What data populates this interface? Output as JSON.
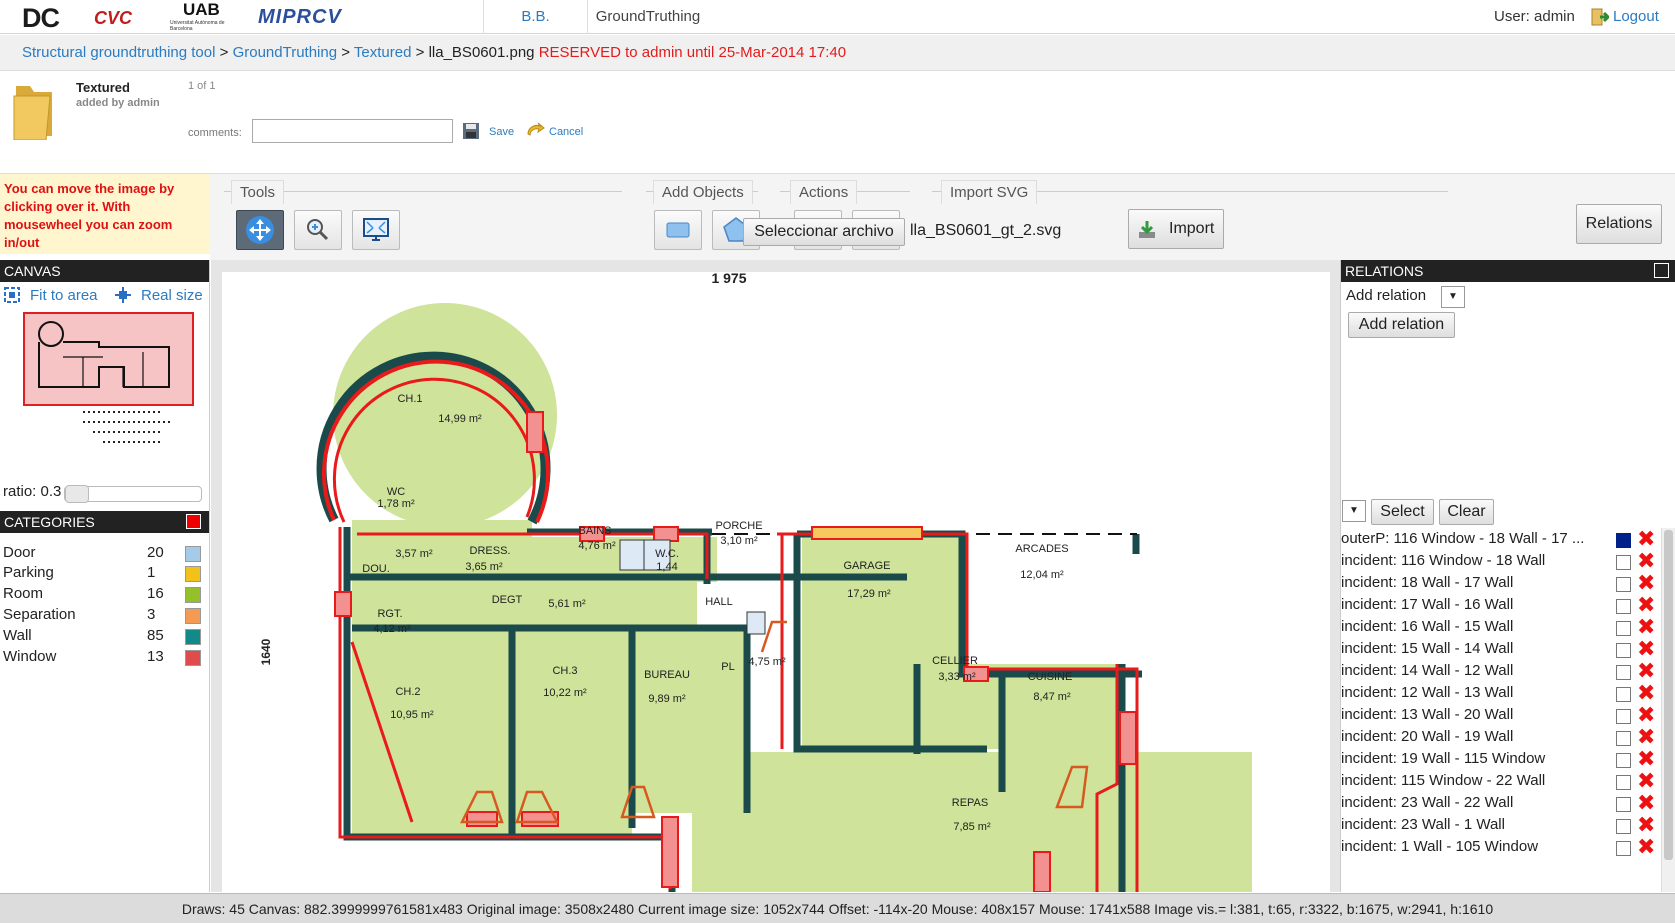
{
  "header": {
    "logos": [
      "DC",
      "CVC",
      "UAB",
      "MIPRCV"
    ],
    "uab_sub": "Universitat Autònoma de Barcelona",
    "tabs": [
      "B.B.",
      "GroundTruthing"
    ],
    "user_label": "User: admin",
    "logout_label": "Logout"
  },
  "breadcrumb": {
    "items": [
      "Structural groundtruthing tool",
      "GroundTruthing",
      "Textured"
    ],
    "separator": ">",
    "filename": "lla_BS0601.png",
    "reserved": "RESERVED to admin until 25-Mar-2014 17:40"
  },
  "doc": {
    "title": "Textured",
    "added_by": "added by admin",
    "pager": "1 of 1",
    "comments_label": "comments:",
    "comments_value": "",
    "save_label": "Save",
    "cancel_label": "Cancel"
  },
  "hint": "You can move the image by clicking over it. With mousewheel you can zoom in/out",
  "toolbar": {
    "tools_label": "Tools",
    "add_objects_label": "Add Objects",
    "actions_label": "Actions",
    "import_svg_label": "Import SVG",
    "file_button_label": "Seleccionar archivo",
    "file_name": "lla_BS0601_gt_2.svg",
    "import_label": "Import",
    "relations_label": "Relations"
  },
  "canvas": {
    "header": "CANVAS",
    "fit_label": "Fit to area",
    "real_label": "Real size",
    "ratio_label": "ratio: 0.3",
    "ratio_value": 0.3
  },
  "plan": {
    "top_dimension": "1 975",
    "side_dimension": "1640",
    "rooms": [
      {
        "name": "CH.1",
        "area": "14,99 m²"
      },
      {
        "name": "WC",
        "area": "1,78 m²"
      },
      {
        "name": "DOU.",
        "area": "3,57 m²"
      },
      {
        "name": "DRESS.",
        "area": "3,65 m²"
      },
      {
        "name": "BAINS",
        "area": "4,76 m²"
      },
      {
        "name": "W.C.",
        "area": "1,44"
      },
      {
        "name": "PORCHE",
        "area": "3,10 m²"
      },
      {
        "name": "GARAGE",
        "area": "17,29 m²"
      },
      {
        "name": "ARCADES",
        "area": "12,04 m²"
      },
      {
        "name": "RGT.",
        "area": "4,12 m²"
      },
      {
        "name": "DEGT",
        "area": "5,61 m²"
      },
      {
        "name": "HALL",
        "area": "4,75 m²"
      },
      {
        "name": "PL",
        "area": ""
      },
      {
        "name": "CELLIER",
        "area": "3,33 m²"
      },
      {
        "name": "CUISINE",
        "area": "8,47 m²"
      },
      {
        "name": "CH.2",
        "area": "10,95 m²"
      },
      {
        "name": "CH.3",
        "area": "10,22 m²"
      },
      {
        "name": "BUREAU",
        "area": "9,89 m²"
      },
      {
        "name": "REPAS",
        "area": "7,85 m²"
      }
    ]
  },
  "categories": {
    "header": "CATEGORIES",
    "items": [
      {
        "name": "Door",
        "count": "20",
        "color": "#a6cbe8"
      },
      {
        "name": "Parking",
        "count": "1",
        "color": "#f2c21a"
      },
      {
        "name": "Room",
        "count": "16",
        "color": "#93c02b"
      },
      {
        "name": "Separation",
        "count": "3",
        "color": "#f39b55"
      },
      {
        "name": "Wall",
        "count": "85",
        "color": "#138a8a"
      },
      {
        "name": "Window",
        "count": "13",
        "color": "#e04b4b"
      }
    ]
  },
  "relations": {
    "header": "RELATIONS",
    "add_relation_label": "Add relation",
    "add_relation_button": "Add relation",
    "select_button": "Select",
    "clear_button": "Clear",
    "rows": [
      {
        "text": "outerP: 116 Window - 18 Wall - 17 ...",
        "checked": true
      },
      {
        "text": "incident: 116 Window - 18 Wall",
        "checked": false
      },
      {
        "text": "incident: 18 Wall - 17 Wall",
        "checked": false
      },
      {
        "text": "incident: 17 Wall - 16 Wall",
        "checked": false
      },
      {
        "text": "incident: 16 Wall - 15 Wall",
        "checked": false
      },
      {
        "text": "incident: 15 Wall - 14 Wall",
        "checked": false
      },
      {
        "text": "incident: 14 Wall - 12 Wall",
        "checked": false
      },
      {
        "text": "incident: 12 Wall - 13 Wall",
        "checked": false
      },
      {
        "text": "incident: 13 Wall - 20 Wall",
        "checked": false
      },
      {
        "text": "incident: 20 Wall - 19 Wall",
        "checked": false
      },
      {
        "text": "incident: 19 Wall - 115 Window",
        "checked": false
      },
      {
        "text": "incident: 115 Window - 22 Wall",
        "checked": false
      },
      {
        "text": "incident: 23 Wall - 22 Wall",
        "checked": false
      },
      {
        "text": "incident: 23 Wall - 1 Wall",
        "checked": false
      },
      {
        "text": "incident: 1 Wall - 105 Window",
        "checked": false
      }
    ]
  },
  "status": "Draws: 45 Canvas: 882.3999999761581x483 Original image: 3508x2480 Current image size: 1052x744 Offset: -114x-20 Mouse: 408x157 Mouse: 1741x588 Image vis.= l:381, t:65, r:3322, b:1675, w:2941, h:1610"
}
